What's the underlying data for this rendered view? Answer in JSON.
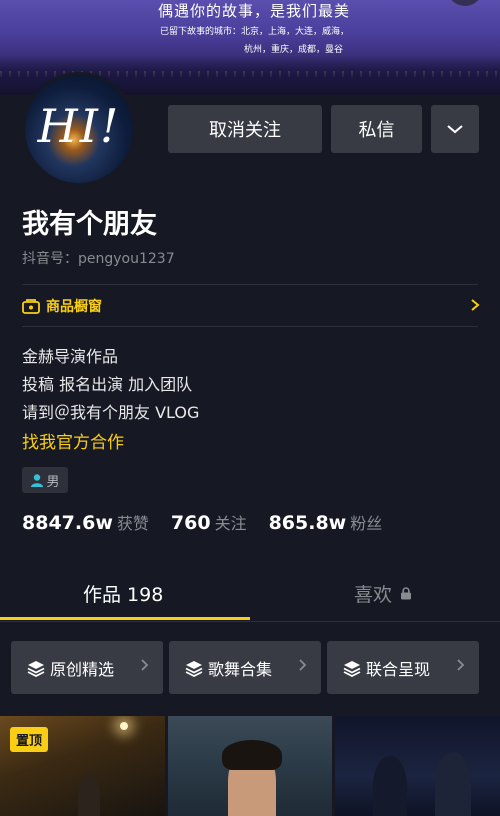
{
  "banner": {
    "headline": "偶遇你的故事，是我们最美",
    "cities_line1": "已留下故事的城市：北京，上海，大连，威海，",
    "cities_line2": "杭州，重庆，成都，曼谷"
  },
  "avatar": {
    "text": "HI!"
  },
  "actions": {
    "unfollow_label": "取消关注",
    "message_label": "私信",
    "more_icon": "chevron-down-icon"
  },
  "profile": {
    "name": "我有个朋友",
    "douyin_id": "抖音号：pengyou1237"
  },
  "shop": {
    "label": "商品橱窗",
    "icon": "shop-icon"
  },
  "bio": {
    "line1": "金赫导演作品",
    "line2": "投稿 报名出演 加入团队",
    "line3": "请到＠我有个朋友 VLOG",
    "link": "找我官方合作"
  },
  "gender": {
    "label": "男",
    "icon": "person-icon"
  },
  "stats": [
    {
      "value": "8847.6w",
      "label": "获赞"
    },
    {
      "value": "760",
      "label": "关注"
    },
    {
      "value": "865.8w",
      "label": "粉丝"
    }
  ],
  "tabs": {
    "works": "作品 198",
    "likes": "喜欢"
  },
  "collections": [
    {
      "label": "原创精选"
    },
    {
      "label": "歌舞合集"
    },
    {
      "label": "联合呈现"
    }
  ],
  "thumbnails": {
    "pinned_label": "置顶"
  },
  "colors": {
    "accent": "#face15",
    "background": "#161823",
    "button": "#393b44"
  }
}
